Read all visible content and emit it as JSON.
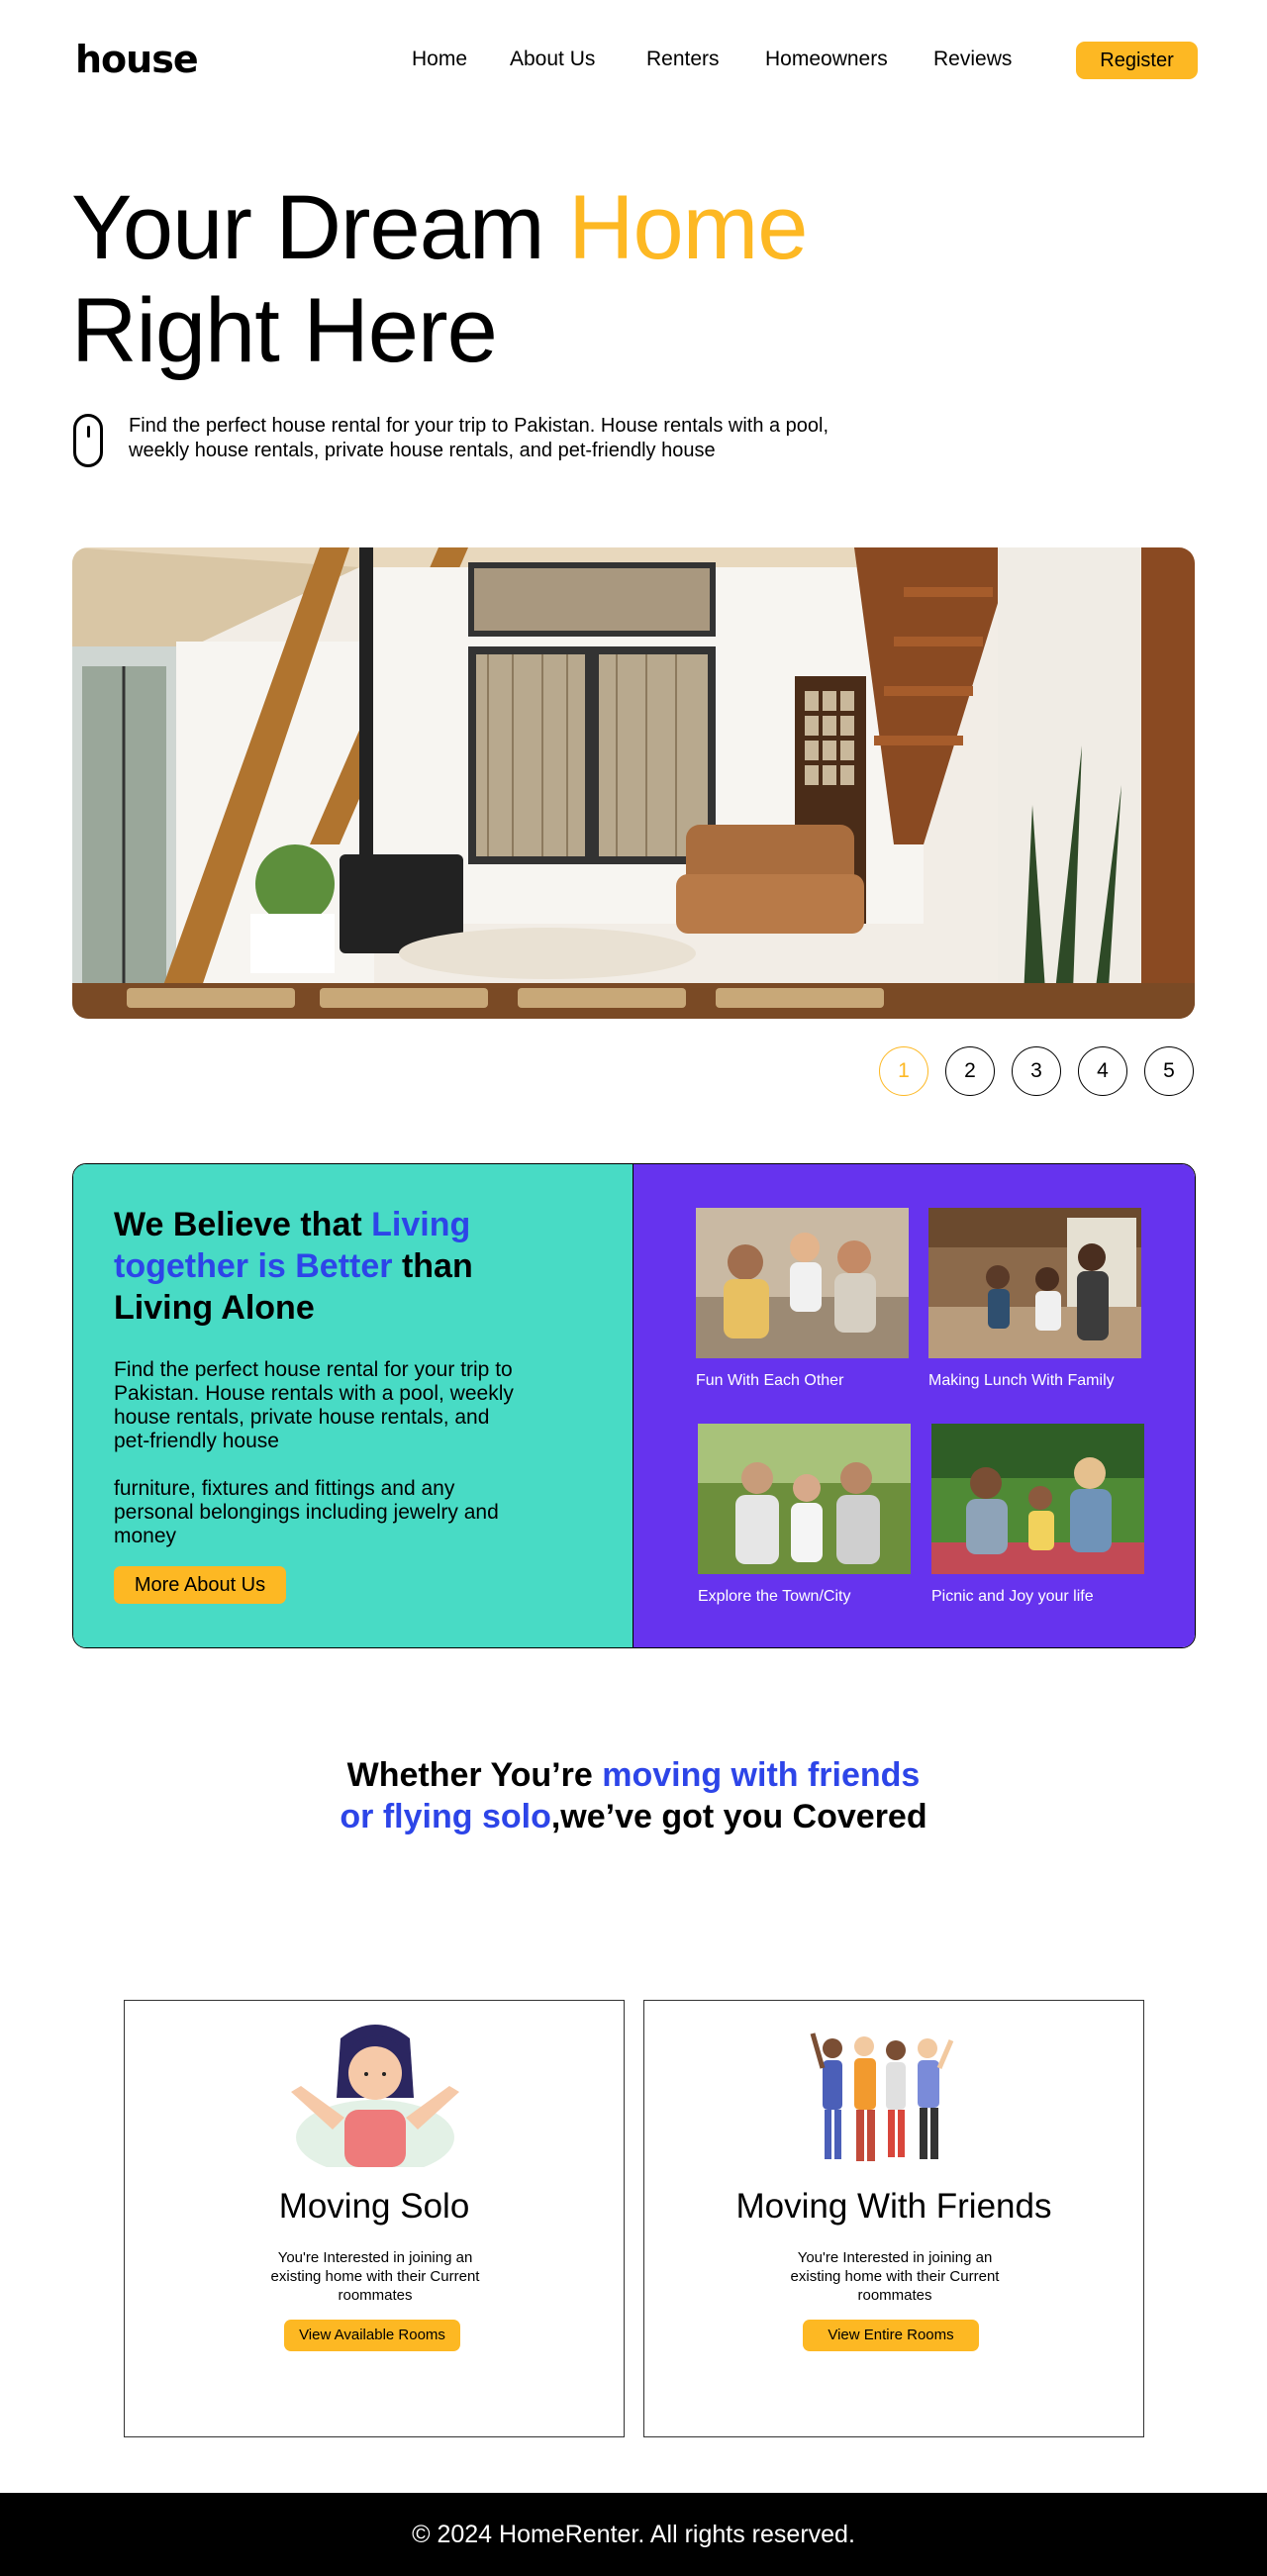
{
  "brand": {
    "logo_text": "house"
  },
  "nav": {
    "items": [
      "Home",
      "About Us",
      "Renters",
      "Homeowners",
      "Reviews"
    ],
    "register_label": "Register"
  },
  "hero": {
    "title_part1": "Your Dream ",
    "title_accent": "Home",
    "title_part2": "Right Here",
    "description": "Find the perfect house rental for your trip to Pakistan. House rentals with a pool, weekly house rentals, private house rentals, and pet-friendly house"
  },
  "carousel": {
    "pages": [
      "1",
      "2",
      "3",
      "4",
      "5"
    ],
    "active": "1"
  },
  "believe": {
    "title_part1": "We Believe that ",
    "title_accent": "Living together is Better",
    "title_part2": " than Living Alone",
    "paragraph1": "Find the perfect house rental for your trip to Pakistan. House rentals with a pool, weekly house rentals, private house rentals, and pet-friendly house",
    "paragraph2": "furniture, fixtures and fittings and any personal belongings including jewelry and money",
    "button_label": "More About Us",
    "photos": [
      {
        "caption": "Fun With Each Other"
      },
      {
        "caption": "Making Lunch With Family"
      },
      {
        "caption": "Explore the Town/City"
      },
      {
        "caption": "Picnic and Joy your life"
      }
    ]
  },
  "covered": {
    "title_part1": "Whether You’re ",
    "title_accent": "moving with friends or flying solo",
    "title_part2": ",we’ve got you Covered"
  },
  "options": [
    {
      "title": "Moving Solo",
      "description": "You're Interested in joining an existing home with their Current roommates",
      "button_label": "View Available Rooms"
    },
    {
      "title": "Moving With Friends",
      "description": "You're Interested in joining an existing home with their Current roommates",
      "button_label": "View Entire Rooms"
    }
  ],
  "footer": {
    "text": "© 2024 HomeRenter. All rights reserved."
  },
  "colors": {
    "accent": "#FDB823",
    "teal": "#48DBC5",
    "purple": "#6633EE",
    "blue": "#2D45E8"
  }
}
